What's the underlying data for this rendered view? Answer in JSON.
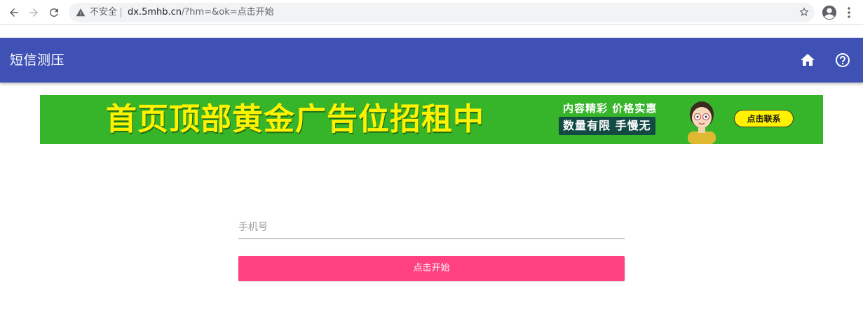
{
  "browser": {
    "security_label": "不安全",
    "url_host": "dx.5mhb.cn",
    "url_path": "/?hm=&ok=点击开始"
  },
  "app": {
    "title": "短信测压",
    "primary_color": "#3f51b5",
    "icons": [
      "home-icon",
      "help-icon"
    ]
  },
  "banner": {
    "headline": "首页顶部黄金广告位招租中",
    "subline": "内容精彩 价格实惠",
    "pill": "数量有限 手慢无",
    "cta": "点击联系",
    "background_color": "#36b52a",
    "headline_color": "#fff200"
  },
  "form": {
    "phone_placeholder": "手机号",
    "phone_value": "",
    "start_button_label": "点击开始",
    "button_color": "#ff4081"
  }
}
